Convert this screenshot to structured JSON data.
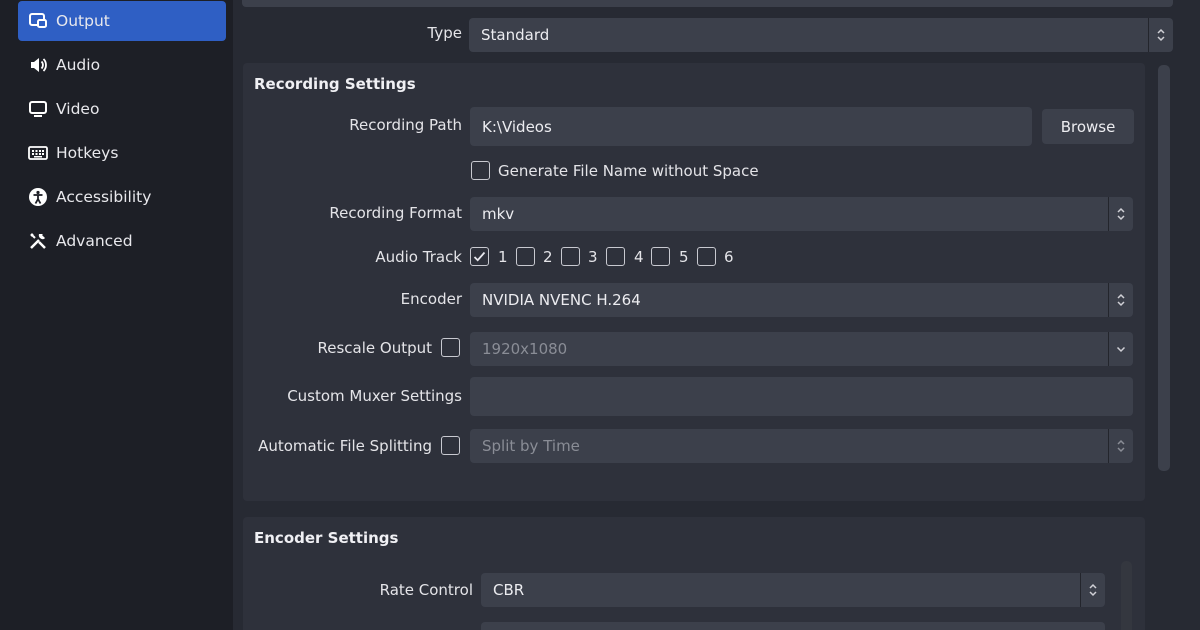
{
  "sidebar": {
    "items": [
      {
        "label": "Output",
        "icon": "output-icon",
        "active": true
      },
      {
        "label": "Audio",
        "icon": "speaker-icon"
      },
      {
        "label": "Video",
        "icon": "monitor-icon"
      },
      {
        "label": "Hotkeys",
        "icon": "keyboard-icon"
      },
      {
        "label": "Accessibility",
        "icon": "accessibility-icon"
      },
      {
        "label": "Advanced",
        "icon": "tools-icon"
      }
    ]
  },
  "output": {
    "type_label": "Type",
    "type_value": "Standard"
  },
  "recording": {
    "title": "Recording Settings",
    "path_label": "Recording Path",
    "path_value": "K:\\Videos",
    "browse_label": "Browse",
    "gen_filename_label": "Generate File Name without Space",
    "gen_filename_checked": false,
    "format_label": "Recording Format",
    "format_value": "mkv",
    "audio_track_label": "Audio Track",
    "tracks": [
      {
        "label": "1",
        "checked": true
      },
      {
        "label": "2",
        "checked": false
      },
      {
        "label": "3",
        "checked": false
      },
      {
        "label": "4",
        "checked": false
      },
      {
        "label": "5",
        "checked": false
      },
      {
        "label": "6",
        "checked": false
      }
    ],
    "encoder_label": "Encoder",
    "encoder_value": "NVIDIA NVENC H.264",
    "rescale_label": "Rescale Output",
    "rescale_checked": false,
    "rescale_value": "1920x1080",
    "muxer_label": "Custom Muxer Settings",
    "muxer_value": "",
    "split_label": "Automatic File Splitting",
    "split_checked": false,
    "split_value": "Split by Time"
  },
  "encoder_settings": {
    "title": "Encoder Settings",
    "rate_control_label": "Rate Control",
    "rate_control_value": "CBR"
  },
  "colors": {
    "accent": "#2f5fc4",
    "background": "#272a33",
    "panel": "#2e313b",
    "field": "#3c404b"
  }
}
